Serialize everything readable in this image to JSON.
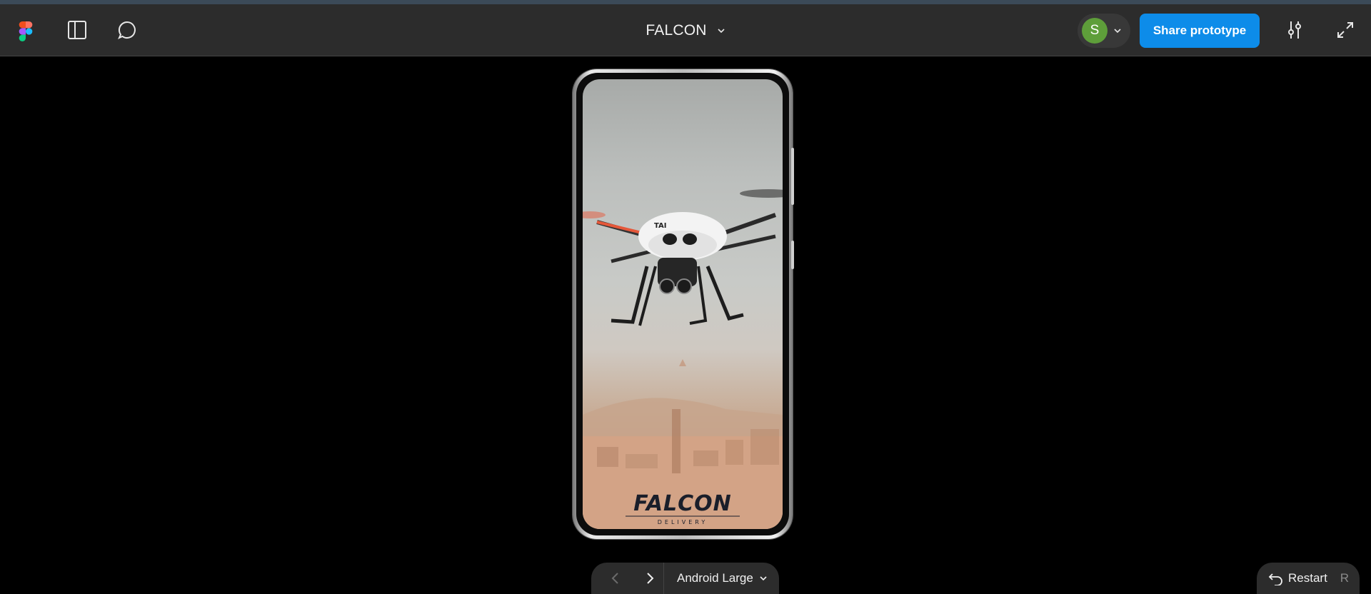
{
  "app": {
    "title": "FALCON",
    "icons": [
      "figma-logo-icon",
      "sidebar-toggle-icon",
      "comment-icon",
      "chevron-down-icon",
      "settings-sliders-icon",
      "fullscreen-icon"
    ]
  },
  "user": {
    "avatar_initial": "S",
    "avatar_color": "#5e9e3a"
  },
  "toolbar": {
    "share_label": "Share prototype"
  },
  "prototype": {
    "logo_text": "FALCON",
    "logo_subtext": "DELIVERY"
  },
  "footer": {
    "device_label": "Android Large",
    "restart_label": "Restart",
    "restart_shortcut": "R"
  },
  "colors": {
    "toolbar_bg": "#2c2c2c",
    "canvas_bg": "#000000",
    "accent": "#0d8ce9"
  }
}
